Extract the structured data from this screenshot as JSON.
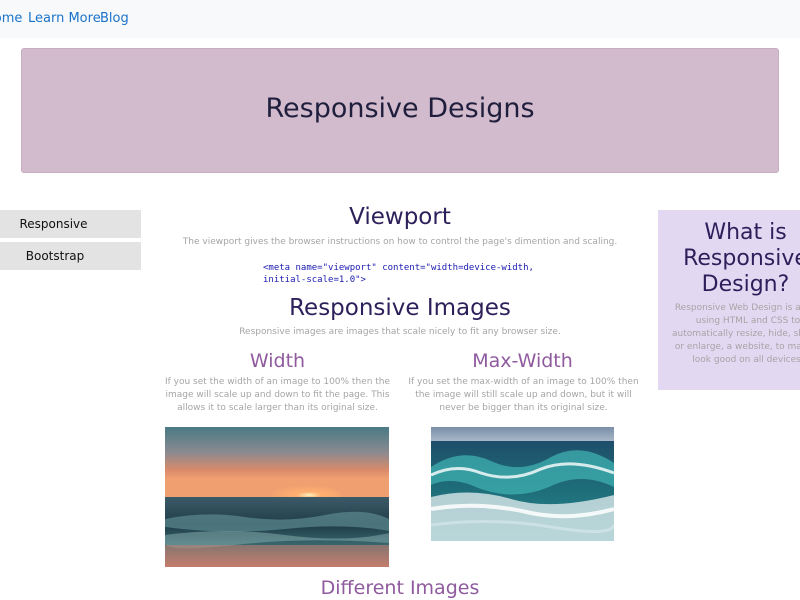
{
  "nav": {
    "home": "Home",
    "learn_more": "Learn More",
    "blog": "Blog"
  },
  "banner": {
    "title": "Responsive Designs"
  },
  "sidebar": {
    "items": [
      "Responsive",
      "Bootstrap"
    ]
  },
  "main": {
    "viewport": {
      "heading": "Viewport",
      "text": "The viewport gives the browser instructions on how to control the page's dimention and scaling.",
      "code": "<meta name=\"viewport\" content=\"width=device-width,\ninitial-scale=1.0\">"
    },
    "responsive_images": {
      "heading": "Responsive Images",
      "text": "Responsive images are images that scale nicely to fit any browser size."
    },
    "width": {
      "heading": "Width",
      "text": "If you set the width of an image to 100% then the image will scale up and down to fit the page. This allows it to scale larger than its original size."
    },
    "max_width": {
      "heading": "Max-Width",
      "text": "If you set the max-width of an image to 100% then the image will still scale up and down, but it will never be bigger than its original size."
    },
    "different_images": {
      "heading": "Different Images"
    }
  },
  "aside": {
    "heading": "What is Responsive Design?",
    "text": "Responsive Web Design is about using HTML and CSS to automatically resize, hide, shrink, or enlarge, a website, to make it look good on all devices."
  },
  "images": {
    "sunset": "sunset-over-ocean-photo",
    "wave": "ocean-wave-photo"
  },
  "colors": {
    "nav_link": "#1a73c9",
    "banner_bg": "#d3bbce",
    "heading_dark": "#2d1f5a",
    "heading_purple": "#8f5a9e",
    "aside_bg": "#e3d8f2",
    "body_text": "#a5a5a5"
  }
}
